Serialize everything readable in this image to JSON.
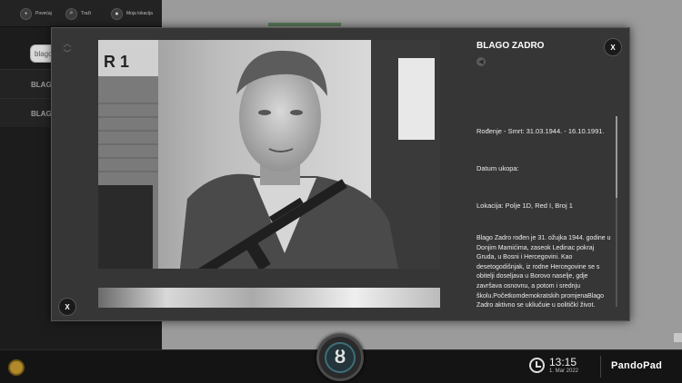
{
  "toolbar": {
    "zoom_label": "Povećaj",
    "search_label": "Traži",
    "location_label": "Moja lokacija"
  },
  "sidebar": {
    "search_value": "blago",
    "items": [
      {
        "label": "BLAGO"
      },
      {
        "label": "BLAGO"
      }
    ]
  },
  "modal": {
    "title": "BLAGO ZADRO",
    "close_label": "X",
    "lines": [
      "Rođenje - Smrt: 31.03.1944. - 16.10.1991.",
      "Datum ukopa:",
      "Lokacija: Polje 1D, Red I, Broj 1"
    ],
    "biography": "Blago Zadro rođen je 31. ožujka 1944. godine u Donjim Mamićima, zaseok Ledinac pokraj Gruda, u Bosni i Hercegovini. Kao desetogodišnjak, iz rodne Hercegovine se s obitelji doseljava u Borovo naselje, gdje završava osnovnu, a potom i srednju školu.Početkomdemokratskih promjenaBlago Zadro aktivno se uključuje u političkí život, jedan"
  },
  "statusbar": {
    "time": "13:15",
    "date": "1. Mar 2022",
    "brand": "PandoPad"
  },
  "colors": {
    "modal_bg": "#363636",
    "accent_home": "#3c6f7a"
  }
}
